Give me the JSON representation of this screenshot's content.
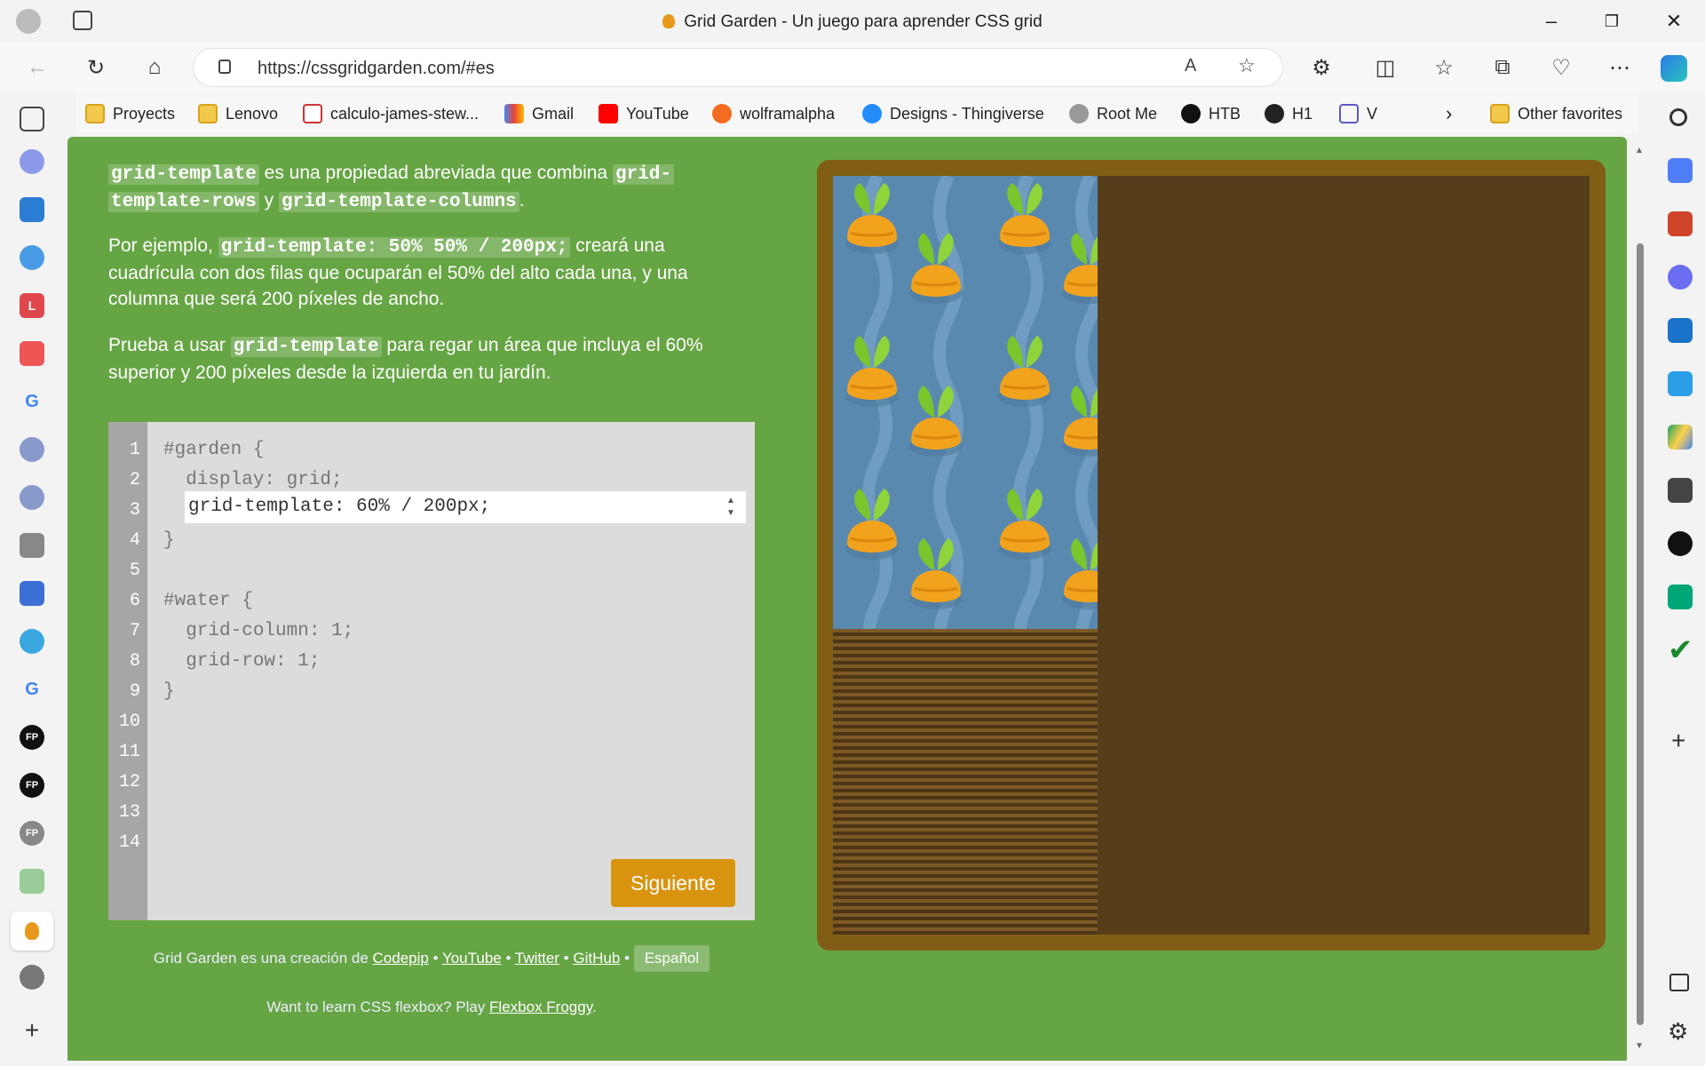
{
  "window": {
    "title": "Grid Garden - Un juego para aprender CSS grid"
  },
  "address": {
    "url": "https://cssgridgarden.com/#es"
  },
  "favorites": [
    {
      "label": "Proyects",
      "icon": "folder-icon"
    },
    {
      "label": "Lenovo",
      "icon": "folder-icon"
    },
    {
      "label": "calculo-james-stew...",
      "icon": "pdf-icon"
    },
    {
      "label": "Gmail",
      "icon": "gmail-icon"
    },
    {
      "label": "YouTube",
      "icon": "youtube-icon"
    },
    {
      "label": "wolframalpha",
      "icon": "wolfram-icon"
    },
    {
      "label": "Designs - Thingiverse",
      "icon": "thingiverse-icon"
    },
    {
      "label": "Root Me",
      "icon": "rootme-icon"
    },
    {
      "label": "HTB",
      "icon": "htb-icon"
    },
    {
      "label": "H1",
      "icon": "h1-icon"
    },
    {
      "label": "V",
      "icon": "v-icon"
    }
  ],
  "other_favorites": "Other favorites",
  "instructions": {
    "p1_code1": "grid-template",
    "p1_text1": " es una propiedad abreviada que combina ",
    "p1_code2a": "grid-",
    "p1_code2b": "template-rows",
    "p1_text2": " y ",
    "p1_code3": "grid-template-columns",
    "p1_text3": ".",
    "p2_text1": "Por ejemplo, ",
    "p2_code": "grid-template: 50% 50% / 200px;",
    "p2_text2": " creará una",
    "p2_line2": "cuadrícula con dos filas que ocuparán el 50% del alto cada una, y una",
    "p2_line3": "columna que será 200 píxeles de ancho.",
    "p3_text1": "Prueba a usar ",
    "p3_code": "grid-template",
    "p3_text2": " para regar un área que incluya el 60%",
    "p3_line2": "superior y 200 píxeles desde la izquierda en tu jardín."
  },
  "editor": {
    "line_numbers": [
      "1",
      "2",
      "3",
      "4",
      "5",
      "6",
      "7",
      "8",
      "9",
      "10",
      "11",
      "12",
      "13",
      "14"
    ],
    "lines": {
      "l1": "#garden {",
      "l2": "  display: grid;",
      "l4": "}",
      "l6": "#water {",
      "l7": "  grid-column: 1;",
      "l8": "  grid-row: 1;",
      "l9": "}"
    },
    "input_value": "grid-template: 60% / 200px;",
    "next_label": "Siguiente"
  },
  "footer": {
    "credit_text": "Grid Garden es una creación de",
    "links": [
      "Codepip",
      "YouTube",
      "Twitter",
      "GitHub"
    ],
    "separator": "•",
    "language": "Español",
    "flexbox_text": "Want to learn CSS flexbox? Play",
    "flexbox_link": "Flexbox Froggy",
    "flexbox_end": "."
  },
  "colors": {
    "page_bg": "#66a544",
    "button": "#d9940f",
    "water": "#5a89b0",
    "soil": "#563e1b"
  }
}
